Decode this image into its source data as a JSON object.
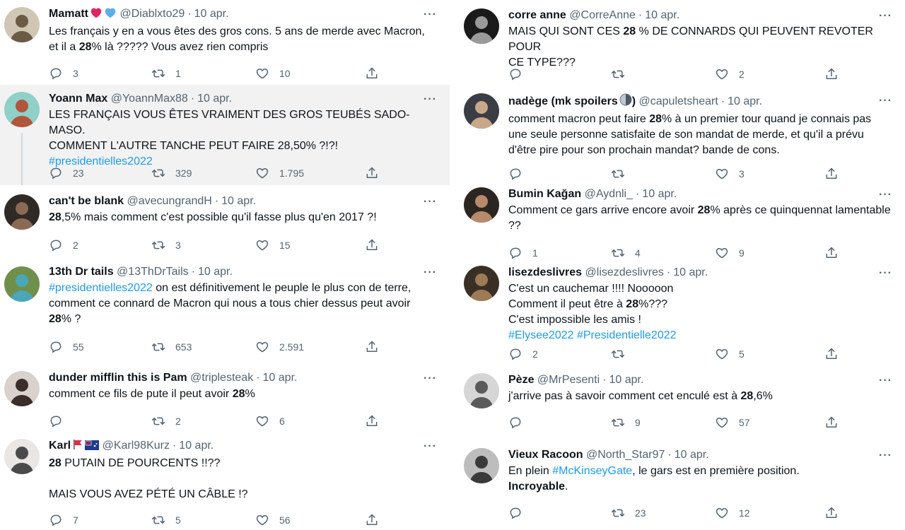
{
  "left": [
    {
      "name": "Mamatt",
      "emojis": [
        "red-heart",
        "blue-heart"
      ],
      "handle": "@Diablxto29",
      "date": "10 apr.",
      "lines": [
        [
          [
            "Les français y en a vous êtes des gros cons. 5 ans de merde avec Macron,",
            "t"
          ]
        ],
        [
          [
            "et il a ",
            "t"
          ],
          [
            "28",
            "b"
          ],
          [
            "% là ????? Vous avez rien compris",
            "t"
          ]
        ]
      ],
      "replies": "3",
      "retweets": "1",
      "likes": "10",
      "avatar": {
        "bg": "#cfc6b4",
        "fg": "#6b5a44"
      }
    },
    {
      "name": "Yoann Max",
      "emojis": [],
      "handle": "@YoannMax88",
      "date": "10 apr.",
      "lines": [
        [
          [
            "LES FRANÇAIS VOUS ÊTES VRAIMENT DES GROS TEUBÉS SADO-MASO.",
            "t"
          ]
        ],
        [
          [
            "COMMENT L'AUTRE TANCHE PEUT FAIRE 28,50% ?!?!",
            "t"
          ]
        ],
        [
          [
            "#presidentielles2022",
            "h"
          ]
        ]
      ],
      "replies": "23",
      "retweets": "329",
      "likes": "1.795",
      "avatar": {
        "bg": "#8fd0c8",
        "fg": "#b0563c"
      }
    },
    {
      "name": "can't be blank",
      "emojis": [],
      "handle": "@avecungrandH",
      "date": "10 apr.",
      "lines": [
        [
          [
            "28",
            "b"
          ],
          [
            ",5% mais comment c'est possible qu'il fasse plus qu'en 2017 ?!",
            "t"
          ]
        ]
      ],
      "replies": "2",
      "retweets": "3",
      "likes": "15",
      "avatar": {
        "bg": "#2f2a26",
        "fg": "#8a6a55"
      }
    },
    {
      "name": "13th Dr tails",
      "emojis": [],
      "handle": "@13ThDrTails",
      "date": "10 apr.",
      "lines": [
        [
          [
            "#presidentielles2022",
            "h"
          ],
          [
            " on est définitivement le peuple le plus con de terre,",
            "t"
          ]
        ],
        [
          [
            "comment ce connard de Macron qui nous a tous chier dessus peut avoir",
            "t"
          ]
        ],
        [
          [
            "28",
            "b"
          ],
          [
            "% ?",
            "t"
          ]
        ]
      ],
      "replies": "55",
      "retweets": "653",
      "likes": "2.591",
      "avatar": {
        "bg": "#6f8f4a",
        "fg": "#4aa7b8"
      }
    },
    {
      "name": "dunder mifflin this is Pam",
      "emojis": [],
      "handle": "@triplesteak",
      "date": "10 apr.",
      "lines": [
        [
          [
            "comment ce fils de pute il peut avoir ",
            "t"
          ],
          [
            "28",
            "b"
          ],
          [
            "%",
            "t"
          ]
        ]
      ],
      "replies": "",
      "retweets": "2",
      "likes": "6",
      "avatar": {
        "bg": "#d9d2cc",
        "fg": "#3b2e2a"
      }
    },
    {
      "name": "Karl",
      "emojis": [
        "flag-red",
        "flag-blue"
      ],
      "handle": "@Karl98Kurz",
      "date": "10 apr.",
      "lines": [
        [
          [
            "28",
            "b"
          ],
          [
            " PUTAIN DE POURCENTS !!??",
            "t"
          ]
        ],
        [
          [
            "",
            "t"
          ]
        ],
        [
          [
            "MAIS VOUS AVEZ PÉTÉ UN CÂBLE !?",
            "t"
          ]
        ]
      ],
      "replies": "7",
      "retweets": "5",
      "likes": "56",
      "avatar": {
        "bg": "#e9e6e4",
        "fg": "#4a4a4a"
      }
    }
  ],
  "right": [
    {
      "name": "corre anne",
      "emojis": [],
      "handle": "@CorreAnne",
      "date": "10 apr.",
      "lines": [
        [
          [
            "MAIS QUI SONT CES ",
            "t"
          ],
          [
            "28",
            "b"
          ],
          [
            " % DE CONNARDS QUI PEUVENT REVOTER POUR",
            "t"
          ]
        ],
        [
          [
            "CE TYPE???",
            "t"
          ]
        ]
      ],
      "replies": "",
      "retweets": "",
      "likes": "2",
      "avatar": {
        "bg": "#1a1a1a",
        "fg": "#9a9a9a"
      }
    },
    {
      "name": "nadège (mk spoilers",
      "emojis": [
        "moon"
      ],
      "nameSuffix": ")",
      "handle": "@capuletsheart",
      "date": "10 apr.",
      "lines": [
        [
          [
            "comment macron peut faire ",
            "t"
          ],
          [
            "28",
            "b"
          ],
          [
            "% à un premier tour quand je connais pas",
            "t"
          ]
        ],
        [
          [
            "une seule personne satisfaite de son mandat de merde, et qu'il a prévu",
            "t"
          ]
        ],
        [
          [
            "d'être pire pour son prochain mandat? bande de cons.",
            "t"
          ]
        ]
      ],
      "replies": "",
      "retweets": "",
      "likes": "3",
      "avatar": {
        "bg": "#3b3d44",
        "fg": "#c9a88a"
      }
    },
    {
      "name": "Bumin Kağan",
      "emojis": [],
      "handle": "@Aydnli_",
      "date": "10 apr.",
      "lines": [
        [
          [
            "Comment ce gars arrive encore avoir ",
            "t"
          ],
          [
            "28",
            "b"
          ],
          [
            "% après ce quinquennat lamentable",
            "t"
          ]
        ],
        [
          [
            "??",
            "t"
          ]
        ]
      ],
      "replies": "1",
      "retweets": "4",
      "likes": "9",
      "avatar": {
        "bg": "#2c2622",
        "fg": "#b78a6c"
      }
    },
    {
      "name": "lisezdeslivres",
      "emojis": [],
      "handle": "@lisezdeslivres",
      "date": "10 apr.",
      "lines": [
        [
          [
            "C'est un cauchemar !!!! Nooooon",
            "t"
          ]
        ],
        [
          [
            "Comment il peut être à ",
            "t"
          ],
          [
            "28",
            "b"
          ],
          [
            "%???",
            "t"
          ]
        ],
        [
          [
            "C'est impossible les amis !",
            "t"
          ]
        ],
        [
          [
            "#Elysee2022",
            "h"
          ],
          [
            " ",
            "t"
          ],
          [
            "#Presidentielle2022",
            "h"
          ]
        ]
      ],
      "replies": "2",
      "retweets": "",
      "likes": "5",
      "avatar": {
        "bg": "#3a2f25",
        "fg": "#9c7b56"
      }
    },
    {
      "name": "Pèze",
      "emojis": [],
      "handle": "@MrPesenti",
      "date": "10 apr.",
      "lines": [
        [
          [
            "j'arrive pas à savoir comment cet enculé est à ",
            "t"
          ],
          [
            "28",
            "b"
          ],
          [
            ",6%",
            "t"
          ]
        ]
      ],
      "replies": "",
      "retweets": "9",
      "likes": "57",
      "avatar": {
        "bg": "#d6d6d6",
        "fg": "#5b5b5b"
      }
    },
    {
      "name": "Vieux Racoon",
      "emojis": [],
      "handle": "@North_Star97",
      "date": "10 apr.",
      "lines": [
        [
          [
            "En plein ",
            "t"
          ],
          [
            "#McKinseyGate",
            "h"
          ],
          [
            ", le gars est en première position.",
            "t"
          ]
        ],
        [
          [
            "Incroyable",
            "b"
          ],
          [
            ".",
            "t"
          ]
        ]
      ],
      "replies": "",
      "retweets": "23",
      "likes": "12",
      "avatar": {
        "bg": "#bdbdbd",
        "fg": "#3a3a3a"
      }
    }
  ],
  "icons": {
    "reply": "reply-icon",
    "retweet": "retweet-icon",
    "like": "like-icon",
    "share": "share-icon",
    "more": "more-icon"
  },
  "more_label": "···"
}
